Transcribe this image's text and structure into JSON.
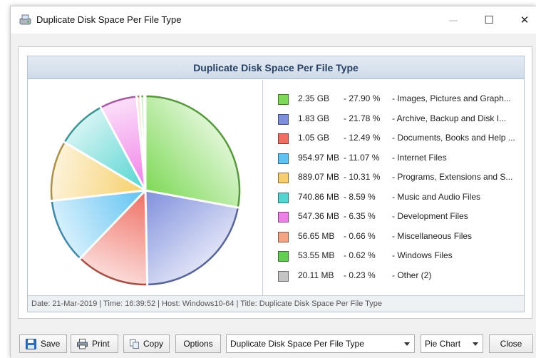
{
  "window": {
    "title": "Duplicate Disk Space Per File Type",
    "minimize_glyph": "—",
    "maximize_glyph": "☐",
    "close_glyph": "✕"
  },
  "chart": {
    "title": "Duplicate Disk Space Per File Type",
    "status": "Date: 21-Mar-2019 | Time: 16:39:52 | Host: Windows10-64 | Title: Duplicate Disk Space Per File Type"
  },
  "chart_data": {
    "type": "pie",
    "title": "Duplicate Disk Space Per File Type",
    "categories": [
      "Images, Pictures and Graph...",
      "Archive, Backup and Disk I...",
      "Documents, Books and Help ...",
      "Internet Files",
      "Programs, Extensions and S...",
      "Music and Audio Files",
      "Development Files",
      "Miscellaneous Files",
      "Windows Files",
      "Other (2)"
    ],
    "sizes": [
      "2.35 GB",
      "1.83 GB",
      "1.05 GB",
      "954.97 MB",
      "889.07 MB",
      "740.86 MB",
      "547.36 MB",
      "56.65 MB",
      "53.55 MB",
      "20.11 MB"
    ],
    "percent_labels": [
      "- 27.90 %",
      "- 21.78 %",
      "- 12.49 %",
      "- 11.07 %",
      "- 10.31 %",
      "- 8.59 %",
      "- 6.35 %",
      "- 0.66 %",
      "- 0.62 %",
      "- 0.23 %"
    ],
    "values": [
      27.9,
      21.78,
      12.49,
      11.07,
      10.31,
      8.59,
      6.35,
      0.66,
      0.62,
      0.23
    ],
    "colors": [
      "#7ed957",
      "#7f8fdc",
      "#ef6f63",
      "#5ec2f2",
      "#f6cf6a",
      "#52d4d0",
      "#f07fe8",
      "#f4a383",
      "#63cf52",
      "#c4c4c4"
    ],
    "legend_placement": "right"
  },
  "legend": [
    {
      "size": "2.35 GB",
      "pct": "- 27.90 %",
      "name": "- Images, Pictures and Graph..."
    },
    {
      "size": "1.83 GB",
      "pct": "- 21.78 %",
      "name": "- Archive, Backup and Disk I..."
    },
    {
      "size": "1.05 GB",
      "pct": "- 12.49 %",
      "name": "- Documents, Books and Help ..."
    },
    {
      "size": "954.97 MB",
      "pct": "- 11.07 %",
      "name": "- Internet Files"
    },
    {
      "size": "889.07 MB",
      "pct": "- 10.31 %",
      "name": "- Programs, Extensions and S..."
    },
    {
      "size": "740.86 MB",
      "pct": "- 8.59 %",
      "name": "- Music and Audio Files"
    },
    {
      "size": "547.36 MB",
      "pct": "- 6.35 %",
      "name": "- Development Files"
    },
    {
      "size": "56.65 MB",
      "pct": "- 0.66 %",
      "name": "- Miscellaneous Files"
    },
    {
      "size": "53.55 MB",
      "pct": "- 0.62 %",
      "name": "- Windows Files"
    },
    {
      "size": "20.11 MB",
      "pct": "- 0.23 %",
      "name": "- Other (2)"
    }
  ],
  "toolbar": {
    "save_label": "Save",
    "print_label": "Print",
    "copy_label": "Copy",
    "options_label": "Options",
    "report_select_value": "Duplicate Disk Space Per File Type",
    "chart_type_value": "Pie Chart",
    "close_label": "Close"
  },
  "icons": {
    "app": "disk-space-app-icon",
    "save": "floppy-disk-icon",
    "print": "printer-icon",
    "copy": "copy-icon"
  }
}
